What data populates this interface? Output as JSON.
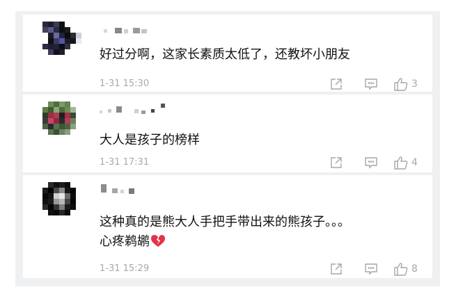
{
  "comments": [
    {
      "text": "好过分啊，这家长素质太低了，还教坏小朋友",
      "text2": "",
      "time": "1-31 15:30",
      "likes": "3"
    },
    {
      "text": "大人是孩子的榜样",
      "text2": "",
      "time": "1-31 17:31",
      "likes": "4"
    },
    {
      "text": "这种真的是熊大人手把手带出来的熊孩子。。。",
      "text2": "心疼鹈鹕",
      "time": "1-31 15:29",
      "likes": "8",
      "emoji": "broken-heart-icon"
    }
  ],
  "icons": {
    "share": "share-icon",
    "comment": "comment-icon",
    "like": "thumbs-up-icon"
  },
  "colors": {
    "panel_bg": "#eef0f2",
    "card_bg": "#ffffff",
    "text": "#111111",
    "meta": "#a8a8a8",
    "icon": "#a6a6a6",
    "heart": "#e0344c"
  }
}
